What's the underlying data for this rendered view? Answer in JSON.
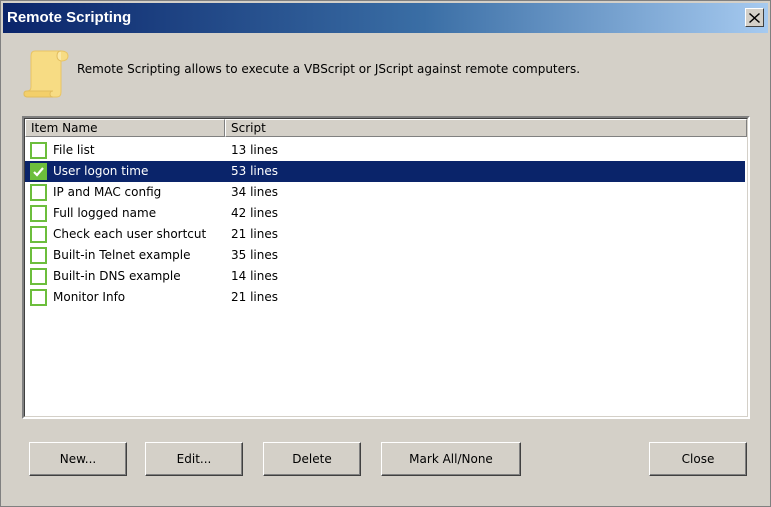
{
  "window": {
    "title": "Remote Scripting"
  },
  "description": "Remote Scripting allows to execute a VBScript or JScript against remote computers.",
  "icons": {
    "header": "scroll-icon",
    "close": "close-icon",
    "check": "checkmark-icon"
  },
  "colors": {
    "title_start": "#0a246a",
    "title_end": "#a6caf0",
    "selection": "#0a246a",
    "checkbox": "#6cbe3c",
    "face": "#d4d0c8"
  },
  "list": {
    "columns": [
      "Item Name",
      "Script"
    ],
    "rows": [
      {
        "name": "File list",
        "script": "13 lines",
        "checked": false,
        "selected": false
      },
      {
        "name": "User logon time",
        "script": "53 lines",
        "checked": true,
        "selected": true
      },
      {
        "name": "IP and MAC config",
        "script": "34 lines",
        "checked": false,
        "selected": false
      },
      {
        "name": "Full logged name",
        "script": "42 lines",
        "checked": false,
        "selected": false
      },
      {
        "name": "Check each user shortcut",
        "script": "21 lines",
        "checked": false,
        "selected": false
      },
      {
        "name": "Built-in Telnet example",
        "script": "35 lines",
        "checked": false,
        "selected": false
      },
      {
        "name": "Built-in DNS example",
        "script": "14 lines",
        "checked": false,
        "selected": false
      },
      {
        "name": "Monitor Info",
        "script": "21 lines",
        "checked": false,
        "selected": false
      }
    ]
  },
  "buttons": {
    "new": "New...",
    "edit": "Edit...",
    "delete": "Delete",
    "mark_all": "Mark All/None",
    "close": "Close"
  }
}
